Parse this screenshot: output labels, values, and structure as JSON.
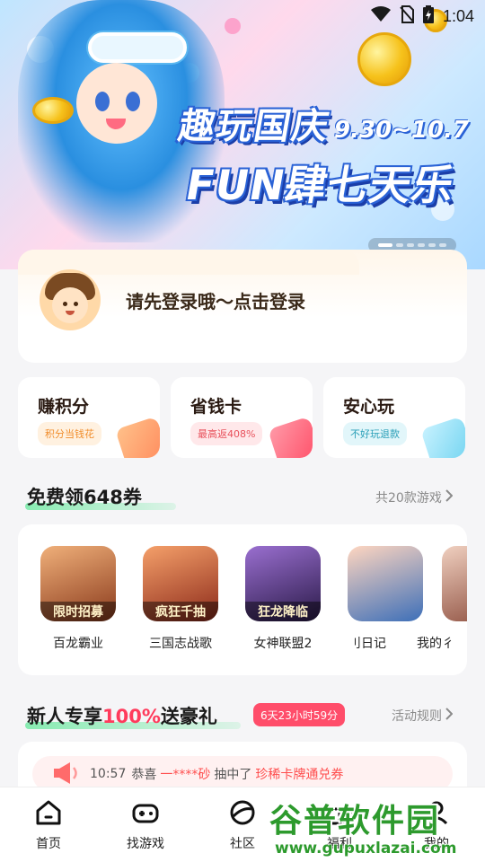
{
  "status_bar": {
    "time": "1:04"
  },
  "banner": {
    "title_cn": "趣玩国庆",
    "date_range": "9.30~10.7",
    "title_fun": "FUN肆七天乐",
    "slides": 6,
    "active_slide": 1
  },
  "login": {
    "prompt": "请先登录哦～点击登录"
  },
  "features": [
    {
      "title": "赚积分",
      "tag": "积分当钱花",
      "tag_color": "#f08c2a",
      "tag_bg": "#fff1e0",
      "deco_color": "#ff9a6c"
    },
    {
      "title": "省钱卡",
      "tag": "最高返408%",
      "tag_color": "#e8505b",
      "tag_bg": "#ffe8ea",
      "deco_color": "#ff6b7f"
    },
    {
      "title": "安心玩",
      "tag": "不好玩退款",
      "tag_color": "#2a9fb8",
      "tag_bg": "#e2f6fa",
      "deco_color": "#7fdcf2"
    }
  ],
  "free_coupons": {
    "title": "免费领648券",
    "link": "共20款游戏"
  },
  "games": [
    {
      "name": "百龙霸业",
      "badge": "限时招募",
      "bg": "#b35a2a"
    },
    {
      "name": "三国志战歌",
      "badge": "疯狂千抽",
      "bg": "#c9512f"
    },
    {
      "name": "女神联盟2",
      "badge": "狂龙降临",
      "bg": "#4a2f6e"
    },
    {
      "name": "刂日记",
      "badge": "",
      "bg": "#3d6fb8"
    },
    {
      "name": "我的彳",
      "badge": "",
      "bg": "#c48a6a"
    }
  ],
  "newcomer": {
    "title_pre": "新人专享",
    "title_hl": "100%",
    "title_post": "送豪礼",
    "timer": "6天23小时59分",
    "link": "活动规则"
  },
  "ticker": {
    "time": "10:57",
    "pre": "恭喜",
    "user": "一****砂",
    "mid": "抽中了",
    "prize": "珍稀卡牌通兑券"
  },
  "nav": [
    {
      "label": "首页",
      "icon": "home-icon"
    },
    {
      "label": "找游戏",
      "icon": "gamepad-icon"
    },
    {
      "label": "社区",
      "icon": "planet-icon"
    },
    {
      "label": "福利",
      "icon": "gift-icon"
    },
    {
      "label": "我的",
      "icon": "profile-icon"
    }
  ],
  "watermark": {
    "top": "谷普软件园",
    "bottom": "www.gupuxlazai.com"
  }
}
